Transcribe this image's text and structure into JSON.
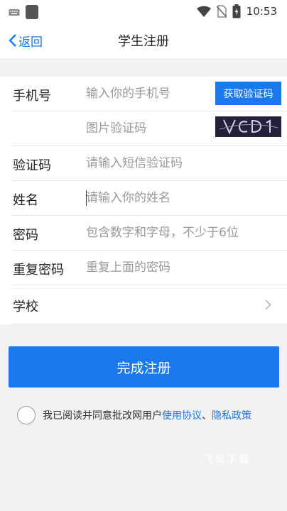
{
  "status_bar": {
    "time": "10:53",
    "icons": [
      "keyboard-icon",
      "app-icon",
      "wifi-icon",
      "no-sim-icon",
      "battery-icon"
    ]
  },
  "nav": {
    "back_label": "返回",
    "title": "学生注册"
  },
  "form": {
    "phone": {
      "label": "手机号",
      "placeholder": "输入你的手机号",
      "button": "获取验证码"
    },
    "image_code": {
      "placeholder": "图片验证码",
      "captcha_text": "VCD1"
    },
    "sms_code": {
      "label": "验证码",
      "placeholder": "请输入短信验证码"
    },
    "name": {
      "label": "姓名",
      "placeholder": "请输入你的姓名"
    },
    "password": {
      "label": "密码",
      "placeholder": "包含数字和字母，不少于6位"
    },
    "confirm_password": {
      "label": "重复密码",
      "placeholder": "重复上面的密码"
    },
    "school": {
      "label": "学校"
    }
  },
  "submit_label": "完成注册",
  "agreement": {
    "text": "我已阅读并同意批改网用户",
    "terms_link": "使用协议",
    "separator": "、",
    "privacy_link": "隐私政策"
  },
  "watermark": "飞鸟下载",
  "colors": {
    "accent": "#1a79ee",
    "background": "#f2f2f4"
  }
}
